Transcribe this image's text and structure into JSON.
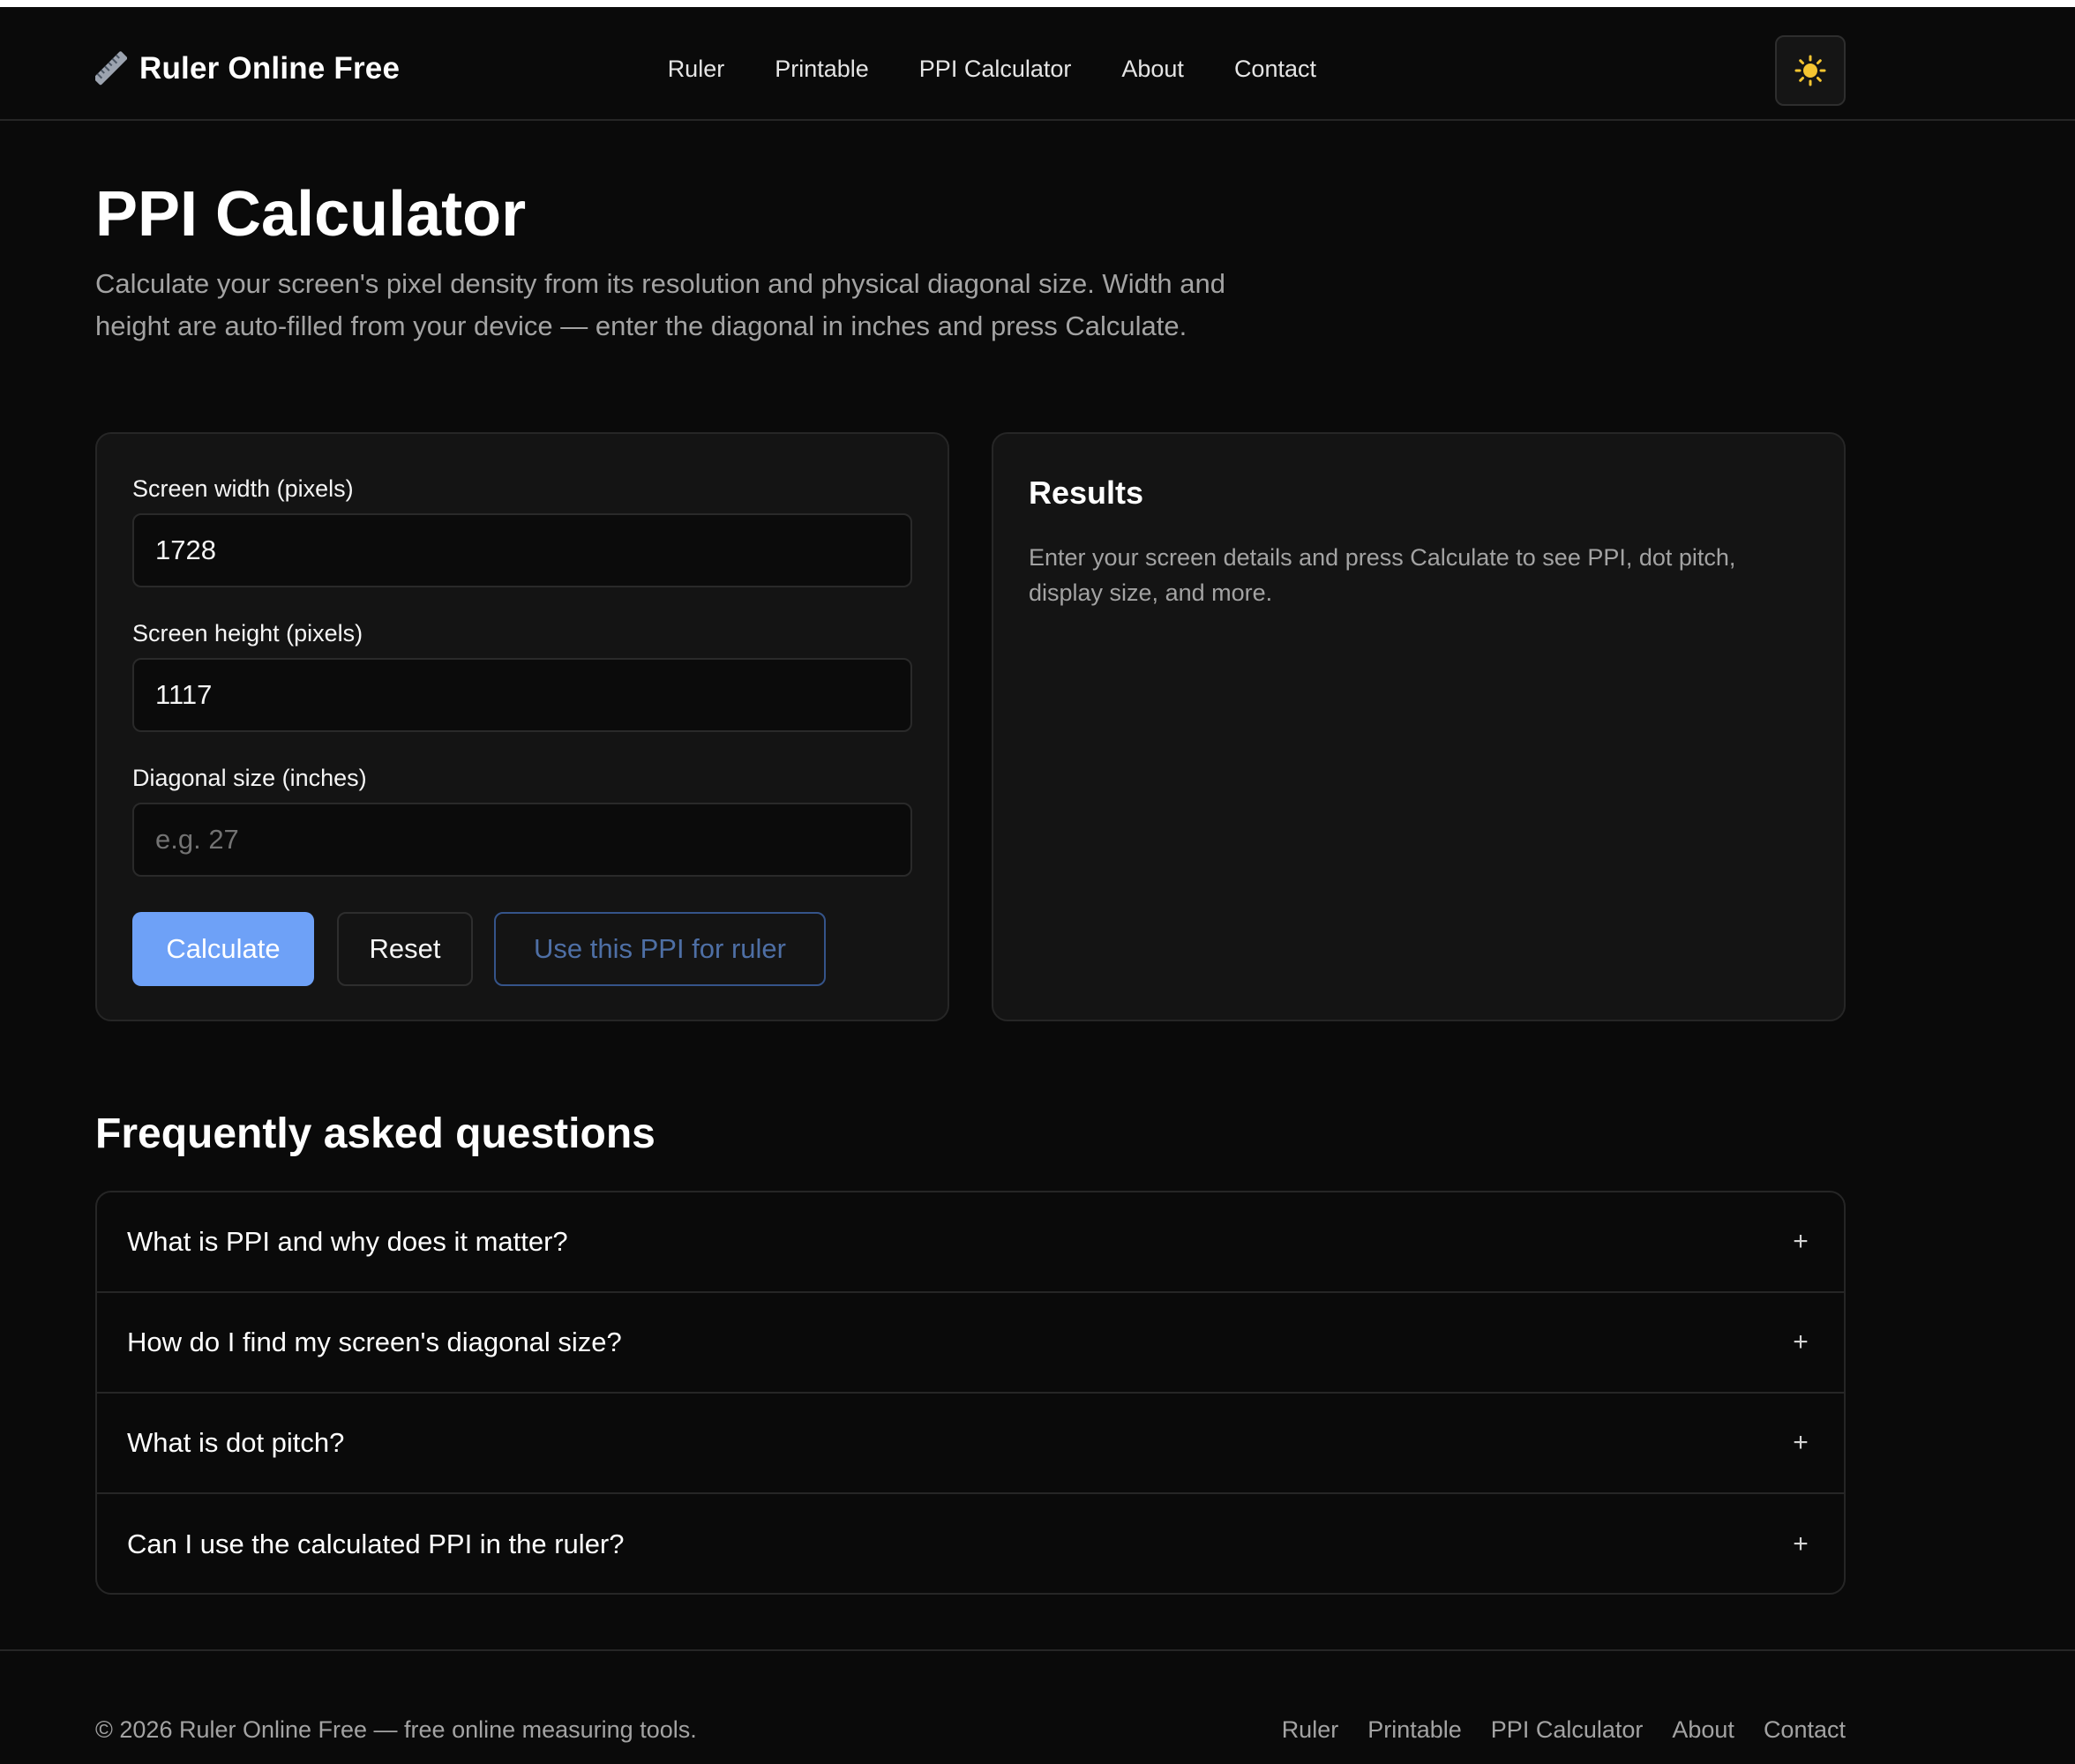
{
  "brand": {
    "name": "Ruler Online Free",
    "icon": "ruler-icon"
  },
  "nav": {
    "items": [
      {
        "label": "Ruler"
      },
      {
        "label": "Printable"
      },
      {
        "label": "PPI Calculator"
      },
      {
        "label": "About"
      },
      {
        "label": "Contact"
      }
    ],
    "theme_toggle_icon": "sun-icon"
  },
  "page": {
    "title": "PPI Calculator",
    "intro": "Calculate your screen's pixel density from its resolution and physical diagonal size. Width and height are auto-filled from your device — enter the diagonal in inches and press Calculate."
  },
  "form": {
    "width_label": "Screen width (pixels)",
    "width_value": "1728",
    "height_label": "Screen height (pixels)",
    "height_value": "1117",
    "diagonal_label": "Diagonal size (inches)",
    "diagonal_value": "",
    "diagonal_placeholder": "e.g. 27",
    "calculate_label": "Calculate",
    "reset_label": "Reset",
    "use_ppi_label": "Use this PPI for ruler"
  },
  "results": {
    "title": "Results",
    "text": "Enter your screen details and press Calculate to see PPI, dot pitch, display size, and more."
  },
  "faq": {
    "title": "Frequently asked questions",
    "expand_icon": "plus-icon",
    "items": [
      {
        "question": "What is PPI and why does it matter?"
      },
      {
        "question": "How do I find my screen's diagonal size?"
      },
      {
        "question": "What is dot pitch?"
      },
      {
        "question": "Can I use the calculated PPI in the ruler?"
      }
    ]
  },
  "footer": {
    "copyright": "© 2026 Ruler Online Free — free online measuring tools.",
    "links": [
      {
        "label": "Ruler"
      },
      {
        "label": "Printable"
      },
      {
        "label": "PPI Calculator"
      },
      {
        "label": "About"
      },
      {
        "label": "Contact"
      }
    ]
  },
  "colors": {
    "background": "#0a0a0a",
    "card": "#141414",
    "accent": "#6ea1f7",
    "text_muted": "#a3a3a3",
    "sun": "#f5c531"
  }
}
